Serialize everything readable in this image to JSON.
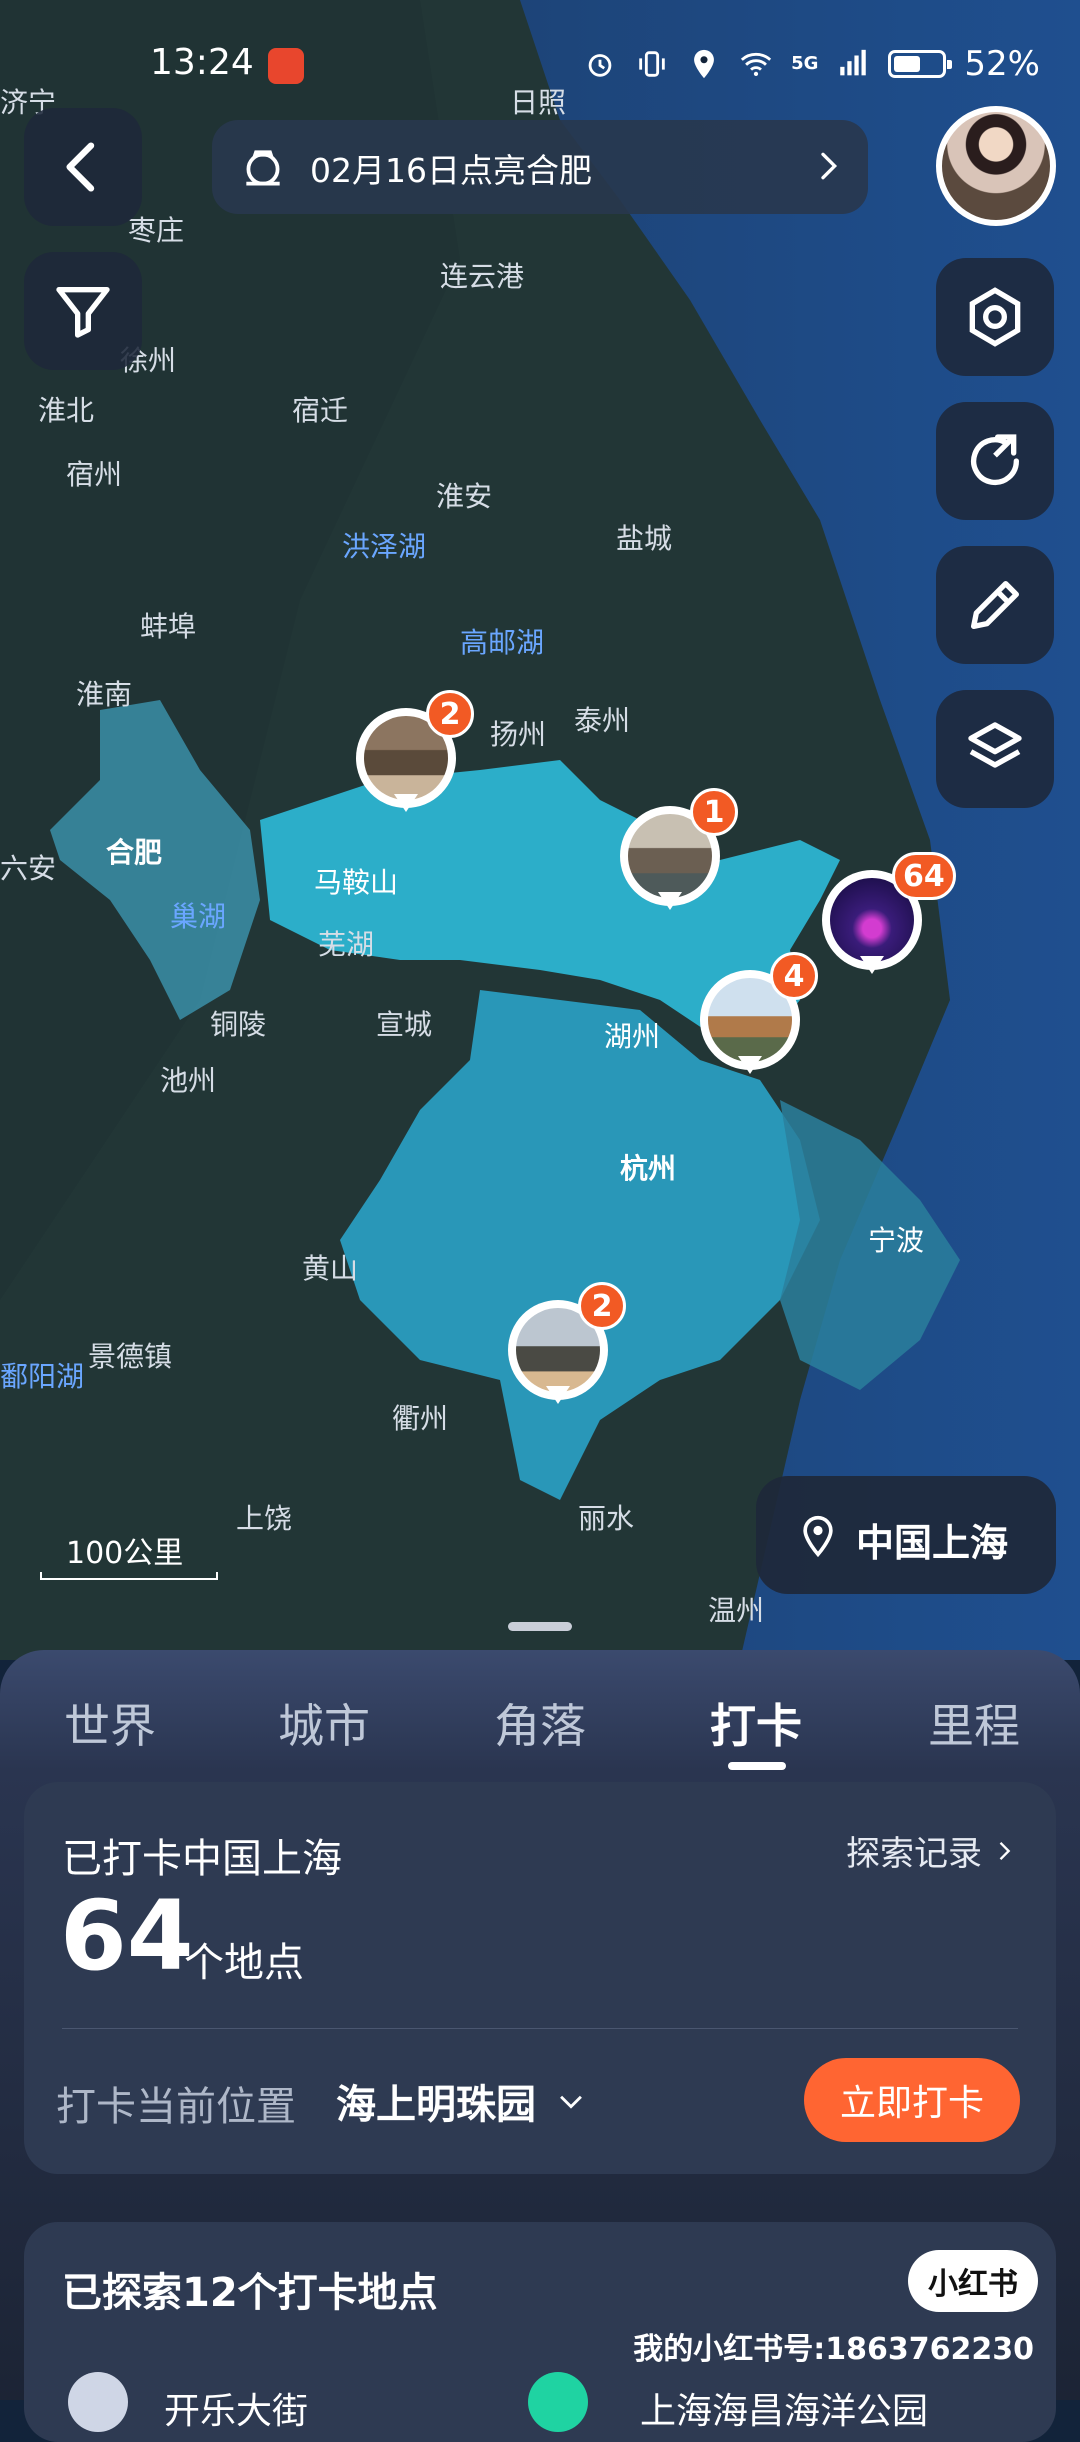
{
  "status_bar": {
    "time": "13:24",
    "battery": "52%",
    "network": "5G"
  },
  "header": {
    "banner_text": "02月16日点亮合肥"
  },
  "map": {
    "place_labels": [
      "济宁",
      "日照",
      "枣庄",
      "连云港",
      "徐州",
      "淮北",
      "宿迁",
      "宿州",
      "淮安",
      "洪泽湖",
      "盐城",
      "蚌埠",
      "高邮湖",
      "淮南",
      "扬州",
      "泰州",
      "六安",
      "合肥",
      "马鞍山",
      "巢湖",
      "芜湖",
      "铜陵",
      "宣城",
      "湖州",
      "池州",
      "杭州",
      "宁波",
      "黄山",
      "景德镇",
      "衢州",
      "鄱阳湖",
      "上饶",
      "丽水",
      "温州"
    ],
    "pins": [
      {
        "name": "nanjing",
        "count": "2"
      },
      {
        "name": "suzhou-north",
        "count": "1"
      },
      {
        "name": "shanghai",
        "count": "64"
      },
      {
        "name": "suzhou",
        "count": "4"
      },
      {
        "name": "south",
        "count": "2"
      }
    ],
    "scale_label": "100公里",
    "location_chip": "中国上海"
  },
  "tabs": [
    "世界",
    "城市",
    "角落",
    "打卡",
    "里程"
  ],
  "active_tab": "打卡",
  "summary_card": {
    "title": "已打卡中国上海",
    "link": "探索记录",
    "count": "64",
    "unit": "个地点",
    "current_label": "打卡当前位置",
    "current_value": "海上明珠园",
    "cta": "立即打卡"
  },
  "explored_card": {
    "title": "已探索12个打卡地点",
    "badge": "小红书",
    "items": [
      "开乐大街",
      "上海海昌海洋公园"
    ]
  },
  "watermark": "我的小红书号:1863762230",
  "colors": {
    "accent": "#ff6532",
    "badge": "#f25a24",
    "region": "#2ec3e3"
  }
}
